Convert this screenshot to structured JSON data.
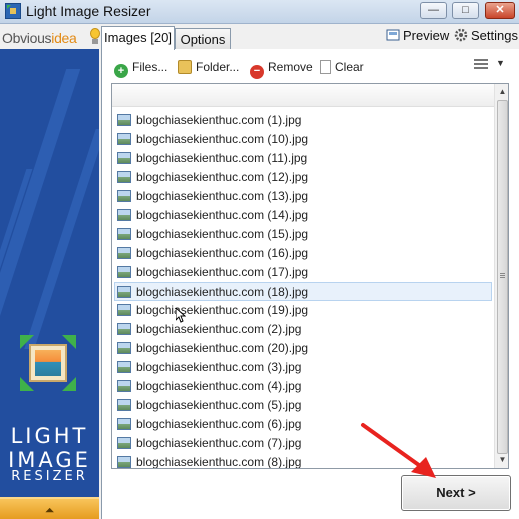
{
  "window": {
    "title": "Light Image Resizer",
    "min_glyph": "—",
    "max_glyph": "□",
    "close_glyph": "✕"
  },
  "header": {
    "logo_part1": "Obvious",
    "logo_part2": "idea",
    "tabs": [
      {
        "label": "Images [20]",
        "active": true
      },
      {
        "label": "Options",
        "active": false
      }
    ],
    "preview_label": "Preview",
    "settings_label": "Settings"
  },
  "sidebar": {
    "brand_line1": "LIGHT",
    "brand_line2": "IMAGE",
    "brand_line3": "RESIZER",
    "collapse_glyph": "⏶",
    "accent": "#224e9f"
  },
  "toolbar": {
    "files_label": "Files...",
    "folder_label": "Folder...",
    "remove_label": "Remove",
    "clear_label": "Clear",
    "view_caret": "▼"
  },
  "files": [
    "blogchiasekienthuc.com (1).jpg",
    "blogchiasekienthuc.com (10).jpg",
    "blogchiasekienthuc.com (11).jpg",
    "blogchiasekienthuc.com (12).jpg",
    "blogchiasekienthuc.com (13).jpg",
    "blogchiasekienthuc.com (14).jpg",
    "blogchiasekienthuc.com (15).jpg",
    "blogchiasekienthuc.com (16).jpg",
    "blogchiasekienthuc.com (17).jpg",
    "blogchiasekienthuc.com (18).jpg",
    "blogchiasekienthuc.com (19).jpg",
    "blogchiasekienthuc.com (2).jpg",
    "blogchiasekienthuc.com (20).jpg",
    "blogchiasekienthuc.com (3).jpg",
    "blogchiasekienthuc.com (4).jpg",
    "blogchiasekienthuc.com (5).jpg",
    "blogchiasekienthuc.com (6).jpg",
    "blogchiasekienthuc.com (7).jpg",
    "blogchiasekienthuc.com (8).jpg"
  ],
  "selected_file_index": 9,
  "footer": {
    "next_label": "Next >"
  },
  "colors": {
    "annotation_arrow": "#e8231f",
    "selection": "#e8f1fb"
  }
}
